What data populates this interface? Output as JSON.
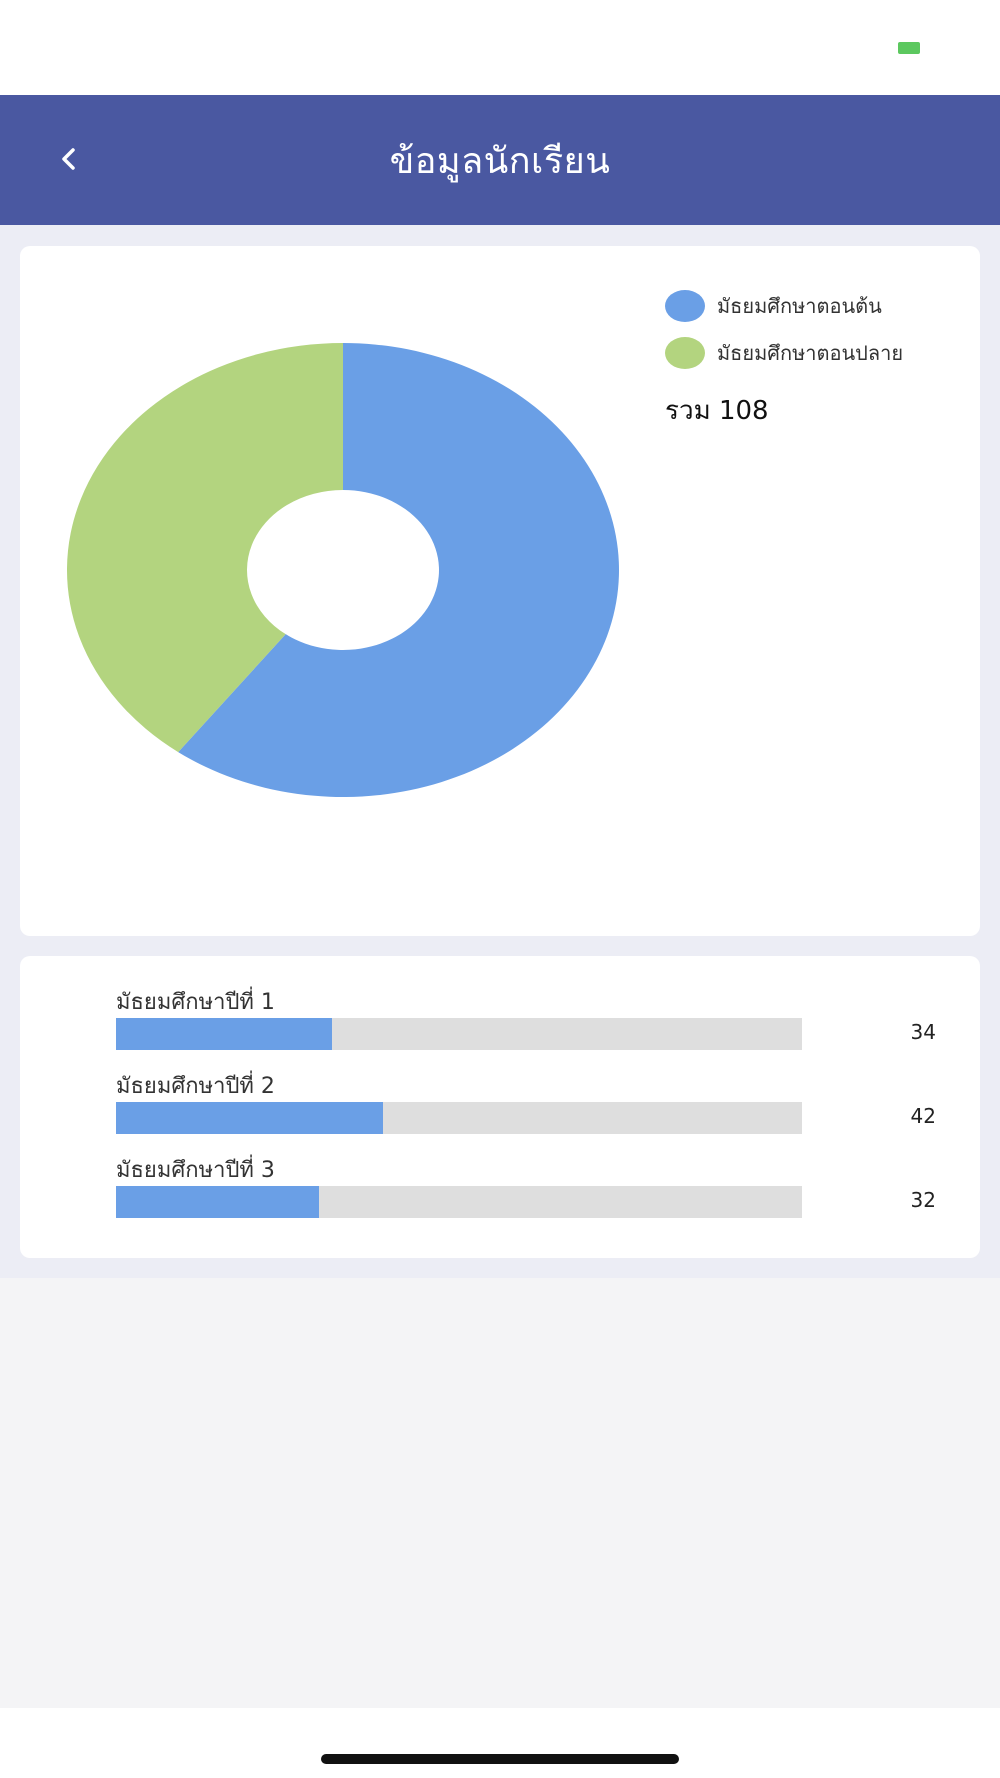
{
  "nav": {
    "title": "ข้อมูลนักเรียน",
    "back_icon": "chevron-left-icon"
  },
  "status": {
    "battery_color": "#5cc85f"
  },
  "colors": {
    "nav_bg": "#4a58a1",
    "lower_secondary": "#6a9fe6",
    "upper_secondary": "#b3d47f",
    "track": "#dedede"
  },
  "chart_data": [
    {
      "type": "pie",
      "style": "donut",
      "labels": [
        "มัธยมศึกษาตอนต้น",
        "มัธยมศึกษาตอนปลาย"
      ],
      "values": [
        65,
        43
      ],
      "colors": [
        "#6a9fe6",
        "#b3d47f"
      ],
      "legend_position": "top-right"
    },
    {
      "type": "bar",
      "orientation": "horizontal",
      "categories": [
        "มัธยมศึกษาปีที่ 1",
        "มัธยมศึกษาปีที่ 2",
        "มัธยมศึกษาปีที่ 3"
      ],
      "values": [
        34,
        42,
        32
      ],
      "xlim": [
        0,
        108
      ],
      "color": "#6a9fe6"
    }
  ],
  "donut": {
    "total_text": "รวม 108"
  },
  "bars": {
    "value_labels": [
      "34",
      "42",
      "32"
    ]
  }
}
